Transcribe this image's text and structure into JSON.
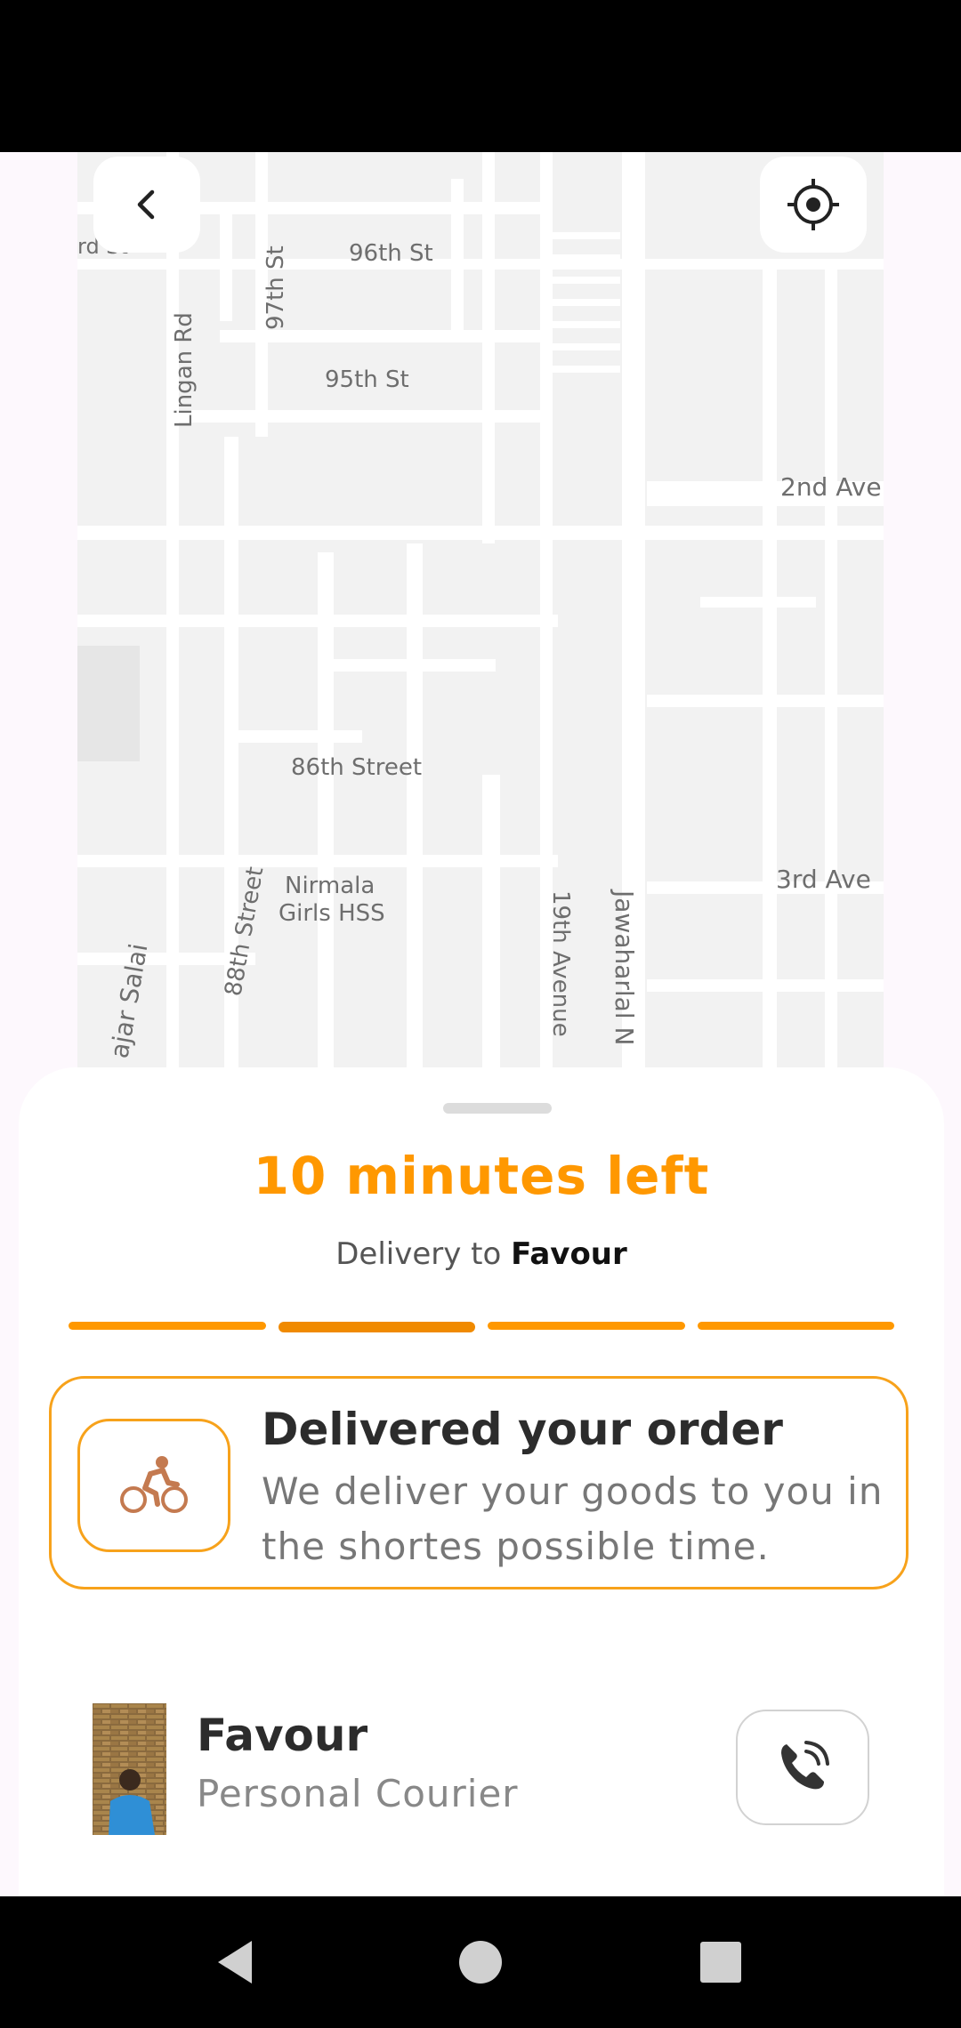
{
  "map": {
    "street_labels": {
      "rd_st": "rd St",
      "st96": "96th St",
      "st97": "97th St",
      "lingan": "Lingan Rd",
      "st95": "95th St",
      "ave2": "2nd Ave",
      "st86": "86th Street",
      "nirmala1": "Nirmala",
      "nirmala2": "Girls HSS",
      "ave3": "3rd Ave",
      "st88": "88th Street",
      "salai": "ajar Salai",
      "ave19": "19th Avenue",
      "jawaharlal": "Jawaharlal N"
    }
  },
  "icons": {
    "back": "chevron-left-icon",
    "locate": "crosshair-icon",
    "status": "bicycle-rider-icon",
    "call": "phone-call-icon"
  },
  "delivery": {
    "eta": "10 minutes left",
    "to_prefix": "Delivery to ",
    "recipient": "Favour",
    "progress_steps": 4,
    "active_step": 2
  },
  "status_card": {
    "title": "Delivered your order",
    "description": "We deliver your goods to you in the shortes possible time."
  },
  "courier": {
    "name": "Favour",
    "role": "Personal Courier"
  },
  "colors": {
    "accent": "#ff9800",
    "icon_brown": "#c47a50"
  }
}
